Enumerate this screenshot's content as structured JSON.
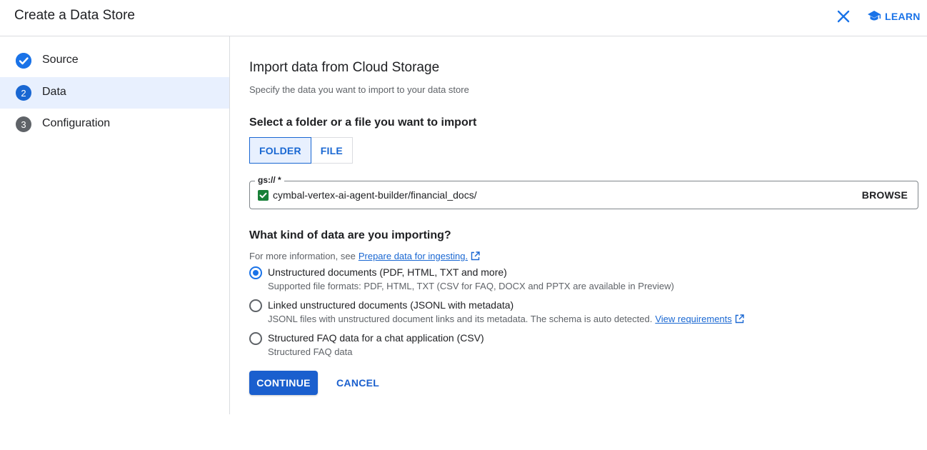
{
  "header": {
    "title": "Create a Data Store",
    "close_icon": "close-icon",
    "learn_icon": "school-icon",
    "learn_label": "LEARN"
  },
  "sidebar": {
    "steps": [
      {
        "marker": "",
        "label": "Source",
        "state": "completed",
        "icon": "check-circle-icon"
      },
      {
        "marker": "2",
        "label": "Data",
        "state": "active"
      },
      {
        "marker": "3",
        "label": "Configuration",
        "state": "pending"
      }
    ]
  },
  "main": {
    "heading": "Import data from Cloud Storage",
    "subheading": "Specify the data you want to import to your data store",
    "select_heading": "Select a folder or a file you want to import",
    "toggle": {
      "options": [
        "FOLDER",
        "FILE"
      ],
      "selected": "FOLDER"
    },
    "path_field": {
      "label": "gs:// *",
      "value": "cymbal-vertex-ai-agent-builder/financial_docs/",
      "browse_label": "BROWSE",
      "status_icon": "check-box-icon"
    },
    "kind_heading": "What kind of data are you importing?",
    "info_prefix": "For more information, see",
    "info_link": "Prepare data for ingesting.",
    "options": [
      {
        "label": "Unstructured documents (PDF, HTML, TXT and more)",
        "description": "Supported file formats: PDF, HTML, TXT (CSV for FAQ, DOCX and PPTX are available in Preview)",
        "checked": true
      },
      {
        "label": "Linked unstructured documents (JSONL with metadata)",
        "description": "JSONL files with unstructured document links and its metadata. The schema is auto detected.",
        "link": "View requirements",
        "checked": false
      },
      {
        "label": "Structured FAQ data for a chat application (CSV)",
        "description": "Structured FAQ data",
        "checked": false
      }
    ],
    "continue_label": "CONTINUE",
    "cancel_label": "CANCEL"
  },
  "colors": {
    "accent": "#1a73e8",
    "primary_button": "#1a5fce",
    "success": "#188038",
    "muted_step": "#5f6368"
  }
}
